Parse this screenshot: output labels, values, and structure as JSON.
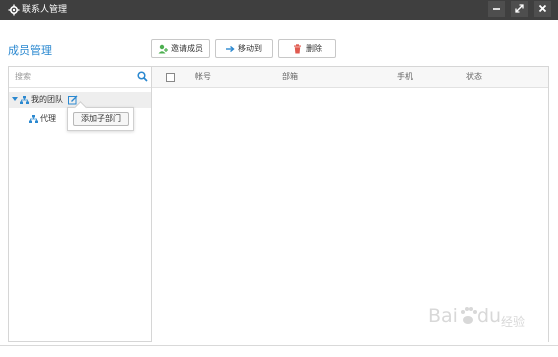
{
  "window": {
    "title": "联系人管理",
    "controls": [
      "minimize",
      "maximize",
      "close"
    ]
  },
  "section_title": "成员管理",
  "toolbar": {
    "invite_label": "邀请成员",
    "move_label": "移动到",
    "delete_label": "删除",
    "colors": {
      "invite_icon": "#4caf50",
      "move_icon": "#2a88d0",
      "delete_icon": "#e05a4f"
    }
  },
  "sidebar": {
    "search_placeholder": "搜索",
    "tree": {
      "root_label": "我的团队",
      "children": [
        {
          "label": "代理"
        }
      ]
    },
    "popup": {
      "add_sub_department_label": "添加子部门"
    }
  },
  "table": {
    "columns": [
      "帐号",
      "部箱",
      "手机",
      "状态"
    ],
    "rows": []
  },
  "watermark": {
    "text": "Bai du 经验"
  },
  "colors": {
    "titlebar": "#3f3f3f",
    "accent": "#2a88d0"
  }
}
